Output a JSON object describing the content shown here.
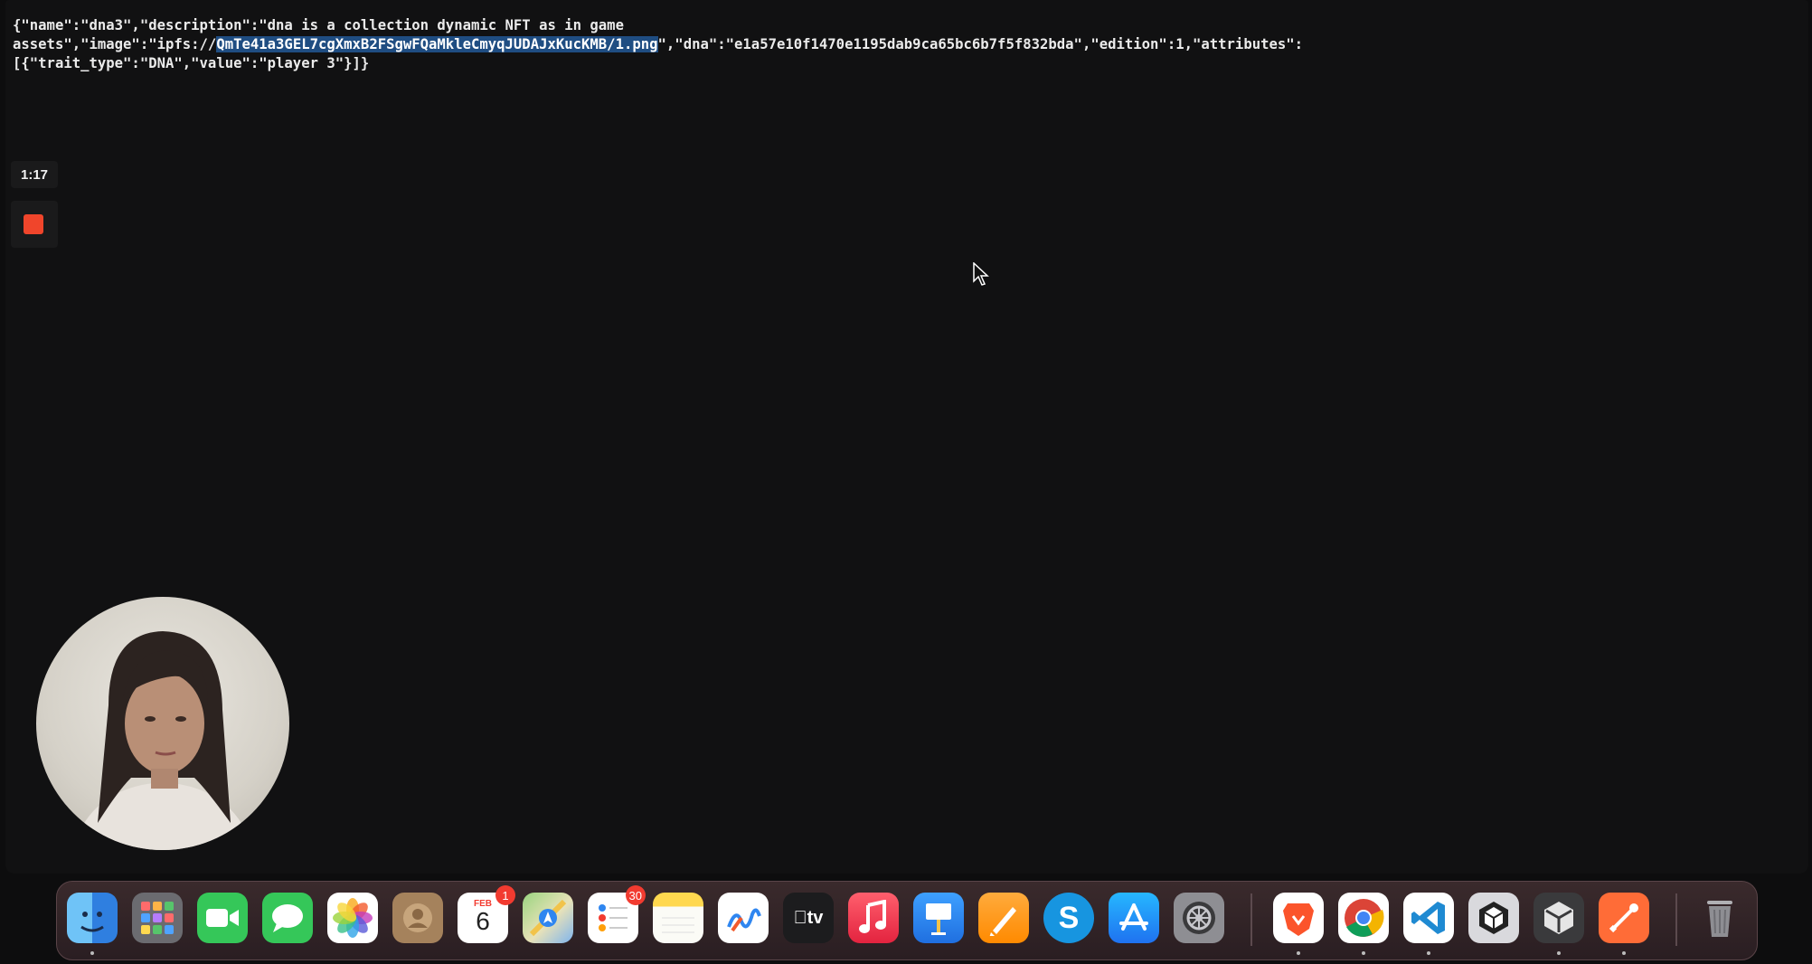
{
  "terminal": {
    "line1": "{\"name\":\"dna3\",\"description\":\"dna is a collection dynamic NFT as in game",
    "line2_pre": "assets\",\"image\":\"ipfs://",
    "line2_sel": "QmTe41a3GEL7cgXmxB2FSgwFQaMkleCmyqJUDAJxKucKMB/1.png",
    "line2_post": "\",\"dna\":\"e1a57e10f1470e1195dab9ca65bc6b7f5f832bda\",\"edition\":1,\"attributes\":",
    "line3": "[{\"trait_type\":\"DNA\",\"value\":\"player 3\"}]}"
  },
  "recorder": {
    "timer": "1:17"
  },
  "dock": {
    "calendar_month": "FEB",
    "calendar_day": "6",
    "calendar_badge": "1",
    "reminders_badge": "30",
    "apps": [
      "Finder",
      "Launchpad",
      "FaceTime",
      "Messages",
      "Photos",
      "Contacts",
      "Calendar",
      "Maps",
      "Reminders",
      "Notes",
      "Freeform",
      "TV",
      "Music",
      "Keynote",
      "Pages",
      "Skype",
      "App Store",
      "System Settings",
      "Brave",
      "Chrome",
      "Visual Studio Code",
      "Unity Hub",
      "Unity",
      "Postman",
      "Trash"
    ],
    "tv_label": "tv",
    "skype_label": "S"
  },
  "colors": {
    "selection": "#1f4d82",
    "record": "#f0452b",
    "background": "#111112"
  }
}
